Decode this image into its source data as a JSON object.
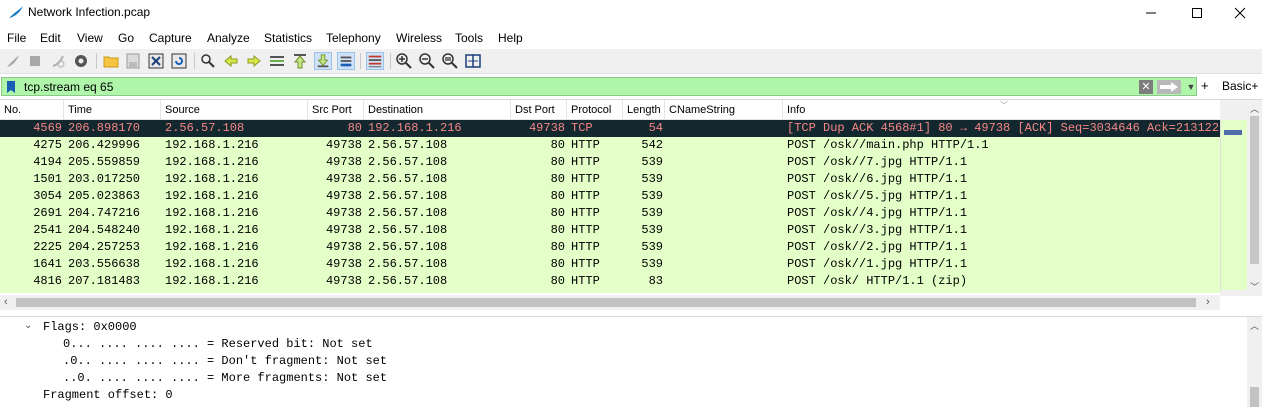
{
  "window": {
    "title": "Network Infection.pcap"
  },
  "menu": [
    "File",
    "Edit",
    "View",
    "Go",
    "Capture",
    "Analyze",
    "Statistics",
    "Telephony",
    "Wireless",
    "Tools",
    "Help"
  ],
  "filter": {
    "value": "tcp.stream eq 65",
    "clear_label": "✕",
    "plus_label": "+",
    "basic_label": "Basic+",
    "dropdown_icon": "chevron-down-icon"
  },
  "packet_list": {
    "columns": [
      "No.",
      "Time",
      "Source",
      "Src Port",
      "Destination",
      "Dst Port",
      "Protocol",
      "Length",
      "CNameString",
      "Info"
    ],
    "rows": [
      {
        "no": "4569",
        "time": "206.898170",
        "src": "2.56.57.108",
        "sport": "80",
        "dst": "192.168.1.216",
        "dport": "49738",
        "proto": "TCP",
        "len": "54",
        "cname": "",
        "info": "[TCP Dup ACK 4568#1] 80 → 49738 [ACK] Seq=3034646 Ack=213122 …",
        "selected": true
      },
      {
        "no": "4275",
        "time": "206.429996",
        "src": "192.168.1.216",
        "sport": "49738",
        "dst": "2.56.57.108",
        "dport": "80",
        "proto": "HTTP",
        "len": "542",
        "cname": "",
        "info": "POST /osk//main.php HTTP/1.1",
        "selected": false
      },
      {
        "no": "4194",
        "time": "205.559859",
        "src": "192.168.1.216",
        "sport": "49738",
        "dst": "2.56.57.108",
        "dport": "80",
        "proto": "HTTP",
        "len": "539",
        "cname": "",
        "info": "POST /osk//7.jpg HTTP/1.1",
        "selected": false
      },
      {
        "no": "1501",
        "time": "203.017250",
        "src": "192.168.1.216",
        "sport": "49738",
        "dst": "2.56.57.108",
        "dport": "80",
        "proto": "HTTP",
        "len": "539",
        "cname": "",
        "info": "POST /osk//6.jpg HTTP/1.1",
        "selected": false
      },
      {
        "no": "3054",
        "time": "205.023863",
        "src": "192.168.1.216",
        "sport": "49738",
        "dst": "2.56.57.108",
        "dport": "80",
        "proto": "HTTP",
        "len": "539",
        "cname": "",
        "info": "POST /osk//5.jpg HTTP/1.1",
        "selected": false
      },
      {
        "no": "2691",
        "time": "204.747216",
        "src": "192.168.1.216",
        "sport": "49738",
        "dst": "2.56.57.108",
        "dport": "80",
        "proto": "HTTP",
        "len": "539",
        "cname": "",
        "info": "POST /osk//4.jpg HTTP/1.1",
        "selected": false
      },
      {
        "no": "2541",
        "time": "204.548240",
        "src": "192.168.1.216",
        "sport": "49738",
        "dst": "2.56.57.108",
        "dport": "80",
        "proto": "HTTP",
        "len": "539",
        "cname": "",
        "info": "POST /osk//3.jpg HTTP/1.1",
        "selected": false
      },
      {
        "no": "2225",
        "time": "204.257253",
        "src": "192.168.1.216",
        "sport": "49738",
        "dst": "2.56.57.108",
        "dport": "80",
        "proto": "HTTP",
        "len": "539",
        "cname": "",
        "info": "POST /osk//2.jpg HTTP/1.1",
        "selected": false
      },
      {
        "no": "1641",
        "time": "203.556638",
        "src": "192.168.1.216",
        "sport": "49738",
        "dst": "2.56.57.108",
        "dport": "80",
        "proto": "HTTP",
        "len": "539",
        "cname": "",
        "info": "POST /osk//1.jpg HTTP/1.1",
        "selected": false
      },
      {
        "no": "4816",
        "time": "207.181483",
        "src": "192.168.1.216",
        "sport": "49738",
        "dst": "2.56.57.108",
        "dport": "80",
        "proto": "HTTP",
        "len": "83",
        "cname": "",
        "info": "POST /osk/ HTTP/1.1  (zip)",
        "selected": false
      }
    ]
  },
  "details": {
    "flags_header": "Flags: 0x0000",
    "flag_lines": [
      "0... .... .... .... = Reserved bit: Not set",
      ".0.. .... .... .... = Don't fragment: Not set",
      "..0. .... .... .... = More fragments: Not set"
    ],
    "fragment_offset": "Fragment offset: 0"
  },
  "colors": {
    "row_bg": "#e4ffc7",
    "selected_bg": "#12272e",
    "selected_fg": "#f78787",
    "filter_bg": "#aff5aa"
  }
}
